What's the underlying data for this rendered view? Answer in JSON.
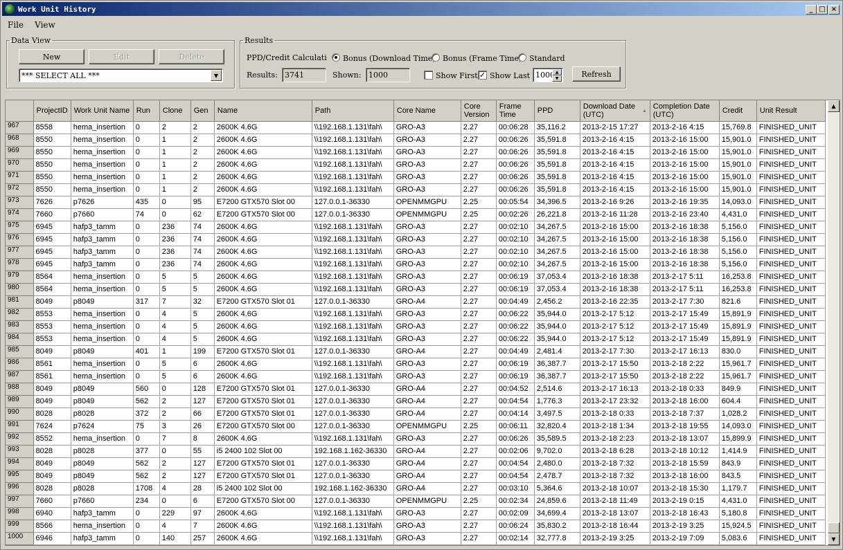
{
  "window": {
    "title": "Work Unit History",
    "icon": "folding-at-home-icon"
  },
  "menu": [
    "File",
    "View"
  ],
  "data_view": {
    "legend": "Data View",
    "new_label": "New",
    "edit_label": "Edit",
    "delete_label": "Delete",
    "select_value": "*** SELECT ALL ***"
  },
  "results": {
    "legend": "Results",
    "calc_label": "PPD/Credit Calculati",
    "bonus_download": "Bonus (Download Time)",
    "bonus_frame": "Bonus (Frame Time)",
    "standard": "Standard",
    "selected_mode": "bonus_download",
    "results_label": "Results:",
    "results_value": "3741",
    "shown_label": "Shown:",
    "shown_value": "1000",
    "show_first_label": "Show First",
    "show_first_checked": false,
    "show_last_label": "Show Last",
    "show_last_checked": true,
    "show_last_value": "1000",
    "refresh_label": "Refresh"
  },
  "table": {
    "columns": [
      "ProjectID",
      "Work Unit Name",
      "Run",
      "Clone",
      "Gen",
      "Name",
      "Path",
      "Core Name",
      "Core Version",
      "Frame Time",
      "PPD",
      "Download Date (UTC)",
      "Completion Date (UTC)",
      "Credit",
      "Unit Result"
    ],
    "rows": [
      [
        "967",
        "8558",
        "hema_insertion",
        "0",
        "2",
        "2",
        "2600K 4.6G",
        "\\\\192.168.1.131\\fah\\",
        "GRO-A3",
        "2.27",
        "00:06:28",
        "35,116.2",
        "2013-2-15 17:27",
        "2013-2-16 4:15",
        "15,769.8",
        "FINISHED_UNIT"
      ],
      [
        "968",
        "8550",
        "hema_insertion",
        "0",
        "1",
        "2",
        "2600K 4.6G",
        "\\\\192.168.1.131\\fah\\",
        "GRO-A3",
        "2.27",
        "00:06:26",
        "35,591.8",
        "2013-2-16 4:15",
        "2013-2-16 15:00",
        "15,901.0",
        "FINISHED_UNIT"
      ],
      [
        "969",
        "8550",
        "hema_insertion",
        "0",
        "1",
        "2",
        "2600K 4.6G",
        "\\\\192.168.1.131\\fah\\",
        "GRO-A3",
        "2.27",
        "00:06:26",
        "35,591.8",
        "2013-2-16 4:15",
        "2013-2-16 15:00",
        "15,901.0",
        "FINISHED_UNIT"
      ],
      [
        "970",
        "8550",
        "hema_insertion",
        "0",
        "1",
        "2",
        "2600K 4.6G",
        "\\\\192.168.1.131\\fah\\",
        "GRO-A3",
        "2.27",
        "00:06:26",
        "35,591.8",
        "2013-2-16 4:15",
        "2013-2-16 15:00",
        "15,901.0",
        "FINISHED_UNIT"
      ],
      [
        "971",
        "8550",
        "hema_insertion",
        "0",
        "1",
        "2",
        "2600K 4.6G",
        "\\\\192.168.1.131\\fah\\",
        "GRO-A3",
        "2.27",
        "00:06:26",
        "35,591.8",
        "2013-2-16 4:15",
        "2013-2-16 15:00",
        "15,901.0",
        "FINISHED_UNIT"
      ],
      [
        "972",
        "8550",
        "hema_insertion",
        "0",
        "1",
        "2",
        "2600K 4.6G",
        "\\\\192.168.1.131\\fah\\",
        "GRO-A3",
        "2.27",
        "00:06:26",
        "35,591.8",
        "2013-2-16 4:15",
        "2013-2-16 15:00",
        "15,901.0",
        "FINISHED_UNIT"
      ],
      [
        "973",
        "7626",
        "p7626",
        "435",
        "0",
        "95",
        "E7200 GTX570 Slot 00",
        "127.0.0.1-36330",
        "OPENMMGPU",
        "2.25",
        "00:05:54",
        "34,396.5",
        "2013-2-16 9:26",
        "2013-2-16 19:35",
        "14,093.0",
        "FINISHED_UNIT"
      ],
      [
        "974",
        "7660",
        "p7660",
        "74",
        "0",
        "62",
        "E7200 GTX570 Slot 00",
        "127.0.0.1-36330",
        "OPENMMGPU",
        "2.25",
        "00:02:26",
        "26,221.8",
        "2013-2-16 11:28",
        "2013-2-16 23:40",
        "4,431.0",
        "FINISHED_UNIT"
      ],
      [
        "975",
        "6945",
        "hafp3_tamm",
        "0",
        "236",
        "74",
        "2600K 4.6G",
        "\\\\192.168.1.131\\fah\\",
        "GRO-A3",
        "2.27",
        "00:02:10",
        "34,267.5",
        "2013-2-16 15:00",
        "2013-2-16 18:38",
        "5,156.0",
        "FINISHED_UNIT"
      ],
      [
        "976",
        "6945",
        "hafp3_tamm",
        "0",
        "236",
        "74",
        "2600K 4.6G",
        "\\\\192.168.1.131\\fah\\",
        "GRO-A3",
        "2.27",
        "00:02:10",
        "34,267.5",
        "2013-2-16 15:00",
        "2013-2-16 18:38",
        "5,156.0",
        "FINISHED_UNIT"
      ],
      [
        "977",
        "6945",
        "hafp3_tamm",
        "0",
        "236",
        "74",
        "2600K 4.6G",
        "\\\\192.168.1.131\\fah\\",
        "GRO-A3",
        "2.27",
        "00:02:10",
        "34,267.5",
        "2013-2-16 15:00",
        "2013-2-16 18:38",
        "5,156.0",
        "FINISHED_UNIT"
      ],
      [
        "978",
        "6945",
        "hafp3_tamm",
        "0",
        "236",
        "74",
        "2600K 4.6G",
        "\\\\192.168.1.131\\fah\\",
        "GRO-A3",
        "2.27",
        "00:02:10",
        "34,267.5",
        "2013-2-16 15:00",
        "2013-2-16 18:38",
        "5,156.0",
        "FINISHED_UNIT"
      ],
      [
        "979",
        "8564",
        "hema_insertion",
        "0",
        "5",
        "5",
        "2600K 4.6G",
        "\\\\192.168.1.131\\fah\\",
        "GRO-A3",
        "2.27",
        "00:06:19",
        "37,053.4",
        "2013-2-16 18:38",
        "2013-2-17 5:11",
        "16,253.8",
        "FINISHED_UNIT"
      ],
      [
        "980",
        "8564",
        "hema_insertion",
        "0",
        "5",
        "5",
        "2600K 4.6G",
        "\\\\192.168.1.131\\fah\\",
        "GRO-A3",
        "2.27",
        "00:06:19",
        "37,053.4",
        "2013-2-16 18:38",
        "2013-2-17 5:11",
        "16,253.8",
        "FINISHED_UNIT"
      ],
      [
        "981",
        "8049",
        "p8049",
        "317",
        "7",
        "32",
        "E7200 GTX570 Slot 01",
        "127.0.0.1-36330",
        "GRO-A4",
        "2.27",
        "00:04:49",
        "2,456.2",
        "2013-2-16 22:35",
        "2013-2-17 7:30",
        "821.6",
        "FINISHED_UNIT"
      ],
      [
        "982",
        "8553",
        "hema_insertion",
        "0",
        "4",
        "5",
        "2600K 4.6G",
        "\\\\192.168.1.131\\fah\\",
        "GRO-A3",
        "2.27",
        "00:06:22",
        "35,944.0",
        "2013-2-17 5:12",
        "2013-2-17 15:49",
        "15,891.9",
        "FINISHED_UNIT"
      ],
      [
        "983",
        "8553",
        "hema_insertion",
        "0",
        "4",
        "5",
        "2600K 4.6G",
        "\\\\192.168.1.131\\fah\\",
        "GRO-A3",
        "2.27",
        "00:06:22",
        "35,944.0",
        "2013-2-17 5:12",
        "2013-2-17 15:49",
        "15,891.9",
        "FINISHED_UNIT"
      ],
      [
        "984",
        "8553",
        "hema_insertion",
        "0",
        "4",
        "5",
        "2600K 4.6G",
        "\\\\192.168.1.131\\fah\\",
        "GRO-A3",
        "2.27",
        "00:06:22",
        "35,944.0",
        "2013-2-17 5:12",
        "2013-2-17 15:49",
        "15,891.9",
        "FINISHED_UNIT"
      ],
      [
        "985",
        "8049",
        "p8049",
        "401",
        "1",
        "199",
        "E7200 GTX570 Slot 01",
        "127.0.0.1-36330",
        "GRO-A4",
        "2.27",
        "00:04:49",
        "2,481.4",
        "2013-2-17 7:30",
        "2013-2-17 16:13",
        "830.0",
        "FINISHED_UNIT"
      ],
      [
        "986",
        "8561",
        "hema_insertion",
        "0",
        "5",
        "6",
        "2600K 4.6G",
        "\\\\192.168.1.131\\fah\\",
        "GRO-A3",
        "2.27",
        "00:06:19",
        "36,387.7",
        "2013-2-17 15:50",
        "2013-2-18 2:22",
        "15,961.7",
        "FINISHED_UNIT"
      ],
      [
        "987",
        "8561",
        "hema_insertion",
        "0",
        "5",
        "6",
        "2600K 4.6G",
        "\\\\192.168.1.131\\fah\\",
        "GRO-A3",
        "2.27",
        "00:06:19",
        "36,387.7",
        "2013-2-17 15:50",
        "2013-2-18 2:22",
        "15,961.7",
        "FINISHED_UNIT"
      ],
      [
        "988",
        "8049",
        "p8049",
        "560",
        "0",
        "128",
        "E7200 GTX570 Slot 01",
        "127.0.0.1-36330",
        "GRO-A4",
        "2.27",
        "00:04:52",
        "2,514.6",
        "2013-2-17 16:13",
        "2013-2-18 0:33",
        "849.9",
        "FINISHED_UNIT"
      ],
      [
        "989",
        "8049",
        "p8049",
        "562",
        "2",
        "127",
        "E7200 GTX570 Slot 01",
        "127.0.0.1-36330",
        "GRO-A4",
        "2.27",
        "00:04:54",
        "1,776.3",
        "2013-2-17 23:32",
        "2013-2-18 16:00",
        "604.4",
        "FINISHED_UNIT"
      ],
      [
        "990",
        "8028",
        "p8028",
        "372",
        "2",
        "66",
        "E7200 GTX570 Slot 01",
        "127.0.0.1-36330",
        "GRO-A4",
        "2.27",
        "00:04:14",
        "3,497.5",
        "2013-2-18 0:33",
        "2013-2-18 7:37",
        "1,028.2",
        "FINISHED_UNIT"
      ],
      [
        "991",
        "7624",
        "p7624",
        "75",
        "3",
        "26",
        "E7200 GTX570 Slot 00",
        "127.0.0.1-36330",
        "OPENMMGPU",
        "2.25",
        "00:06:11",
        "32,820.4",
        "2013-2-18 1:34",
        "2013-2-18 19:55",
        "14,093.0",
        "FINISHED_UNIT"
      ],
      [
        "992",
        "8552",
        "hema_insertion",
        "0",
        "7",
        "8",
        "2600K 4.6G",
        "\\\\192.168.1.131\\fah\\",
        "GRO-A3",
        "2.27",
        "00:06:26",
        "35,589.5",
        "2013-2-18 2:23",
        "2013-2-18 13:07",
        "15,899.9",
        "FINISHED_UNIT"
      ],
      [
        "993",
        "8028",
        "p8028",
        "377",
        "0",
        "55",
        "i5 2400 102 Slot 00",
        "192.168.1.162-36330",
        "GRO-A4",
        "2.27",
        "00:02:06",
        "9,702.0",
        "2013-2-18 6:28",
        "2013-2-18 10:12",
        "1,414.9",
        "FINISHED_UNIT"
      ],
      [
        "994",
        "8049",
        "p8049",
        "562",
        "2",
        "127",
        "E7200 GTX570 Slot 01",
        "127.0.0.1-36330",
        "GRO-A4",
        "2.27",
        "00:04:54",
        "2,480.0",
        "2013-2-18 7:32",
        "2013-2-18 15:59",
        "843.9",
        "FINISHED_UNIT"
      ],
      [
        "995",
        "8049",
        "p8049",
        "562",
        "2",
        "127",
        "E7200 GTX570 Slot 01",
        "127.0.0.1-36330",
        "GRO-A4",
        "2.27",
        "00:04:54",
        "2,478.7",
        "2013-2-18 7:32",
        "2013-2-18 16:00",
        "843.5",
        "FINISHED_UNIT"
      ],
      [
        "996",
        "8028",
        "p8028",
        "1708",
        "4",
        "28",
        "i5 2400 102 Slot 00",
        "192.168.1.162-36330",
        "GRO-A4",
        "2.27",
        "00:03:10",
        "5,364.6",
        "2013-2-18 10:07",
        "2013-2-18 15:30",
        "1,179.7",
        "FINISHED_UNIT"
      ],
      [
        "997",
        "7660",
        "p7660",
        "234",
        "0",
        "6",
        "E7200 GTX570 Slot 00",
        "127.0.0.1-36330",
        "OPENMMGPU",
        "2.25",
        "00:02:34",
        "24,859.6",
        "2013-2-18 11:49",
        "2013-2-19 0:15",
        "4,431.0",
        "FINISHED_UNIT"
      ],
      [
        "998",
        "6940",
        "hafp3_tamm",
        "0",
        "229",
        "97",
        "2600K 4.6G",
        "\\\\192.168.1.131\\fah\\",
        "GRO-A3",
        "2.27",
        "00:02:09",
        "34,699.4",
        "2013-2-18 13:07",
        "2013-2-18 16:43",
        "5,180.8",
        "FINISHED_UNIT"
      ],
      [
        "999",
        "8566",
        "hema_insertion",
        "0",
        "4",
        "7",
        "2600K 4.6G",
        "\\\\192.168.1.131\\fah\\",
        "GRO-A3",
        "2.27",
        "00:06:24",
        "35,830.2",
        "2013-2-18 16:44",
        "2013-2-19 3:25",
        "15,924.5",
        "FINISHED_UNIT"
      ],
      [
        "1000",
        "6946",
        "hafp3_tamm",
        "0",
        "140",
        "257",
        "2600K 4.6G",
        "\\\\192.168.1.131\\fah\\",
        "GRO-A3",
        "2.27",
        "00:02:14",
        "32,777.8",
        "2013-2-19 3:25",
        "2013-2-19 7:09",
        "5,083.6",
        "FINISHED_UNIT"
      ]
    ]
  }
}
